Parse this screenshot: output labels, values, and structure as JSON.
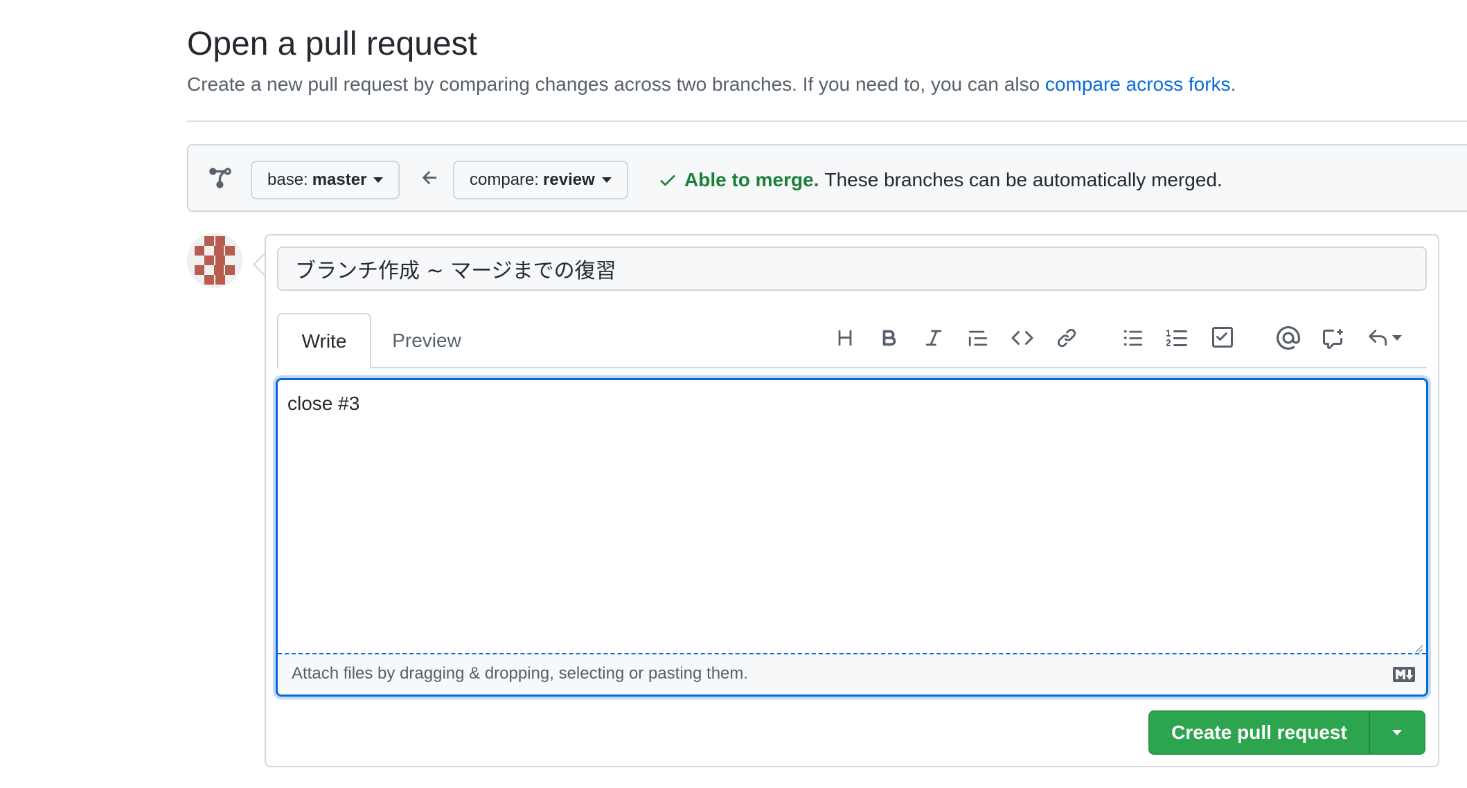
{
  "header": {
    "title": "Open a pull request",
    "subtitle": "Create a new pull request by comparing changes across two branches. If you need to, you can also ",
    "subtitle_link": "compare across forks",
    "subtitle_end": "."
  },
  "range": {
    "base_prefix": "base:",
    "base_branch": "master",
    "compare_prefix": "compare:",
    "compare_branch": "review",
    "merge_ok": "Able to merge.",
    "merge_text": "These branches can be automatically merged."
  },
  "form": {
    "title_value": "ブランチ作成 ~ マージまでの復習",
    "tabs": [
      "Write",
      "Preview"
    ],
    "body_value": "close #3",
    "attach_text": "Attach files by dragging & dropping, selecting or pasting them.",
    "submit_label": "Create pull request"
  },
  "toolbar": {
    "icons": [
      "heading-icon",
      "bold-icon",
      "italic-icon",
      "quote-icon",
      "code-icon",
      "link-icon",
      "unordered-list-icon",
      "ordered-list-icon",
      "task-list-icon",
      "mention-icon",
      "cross-reference-icon",
      "reply-icon"
    ]
  },
  "colors": {
    "accent": "#0969da",
    "success": "#1a7f37",
    "button": "#2da44e",
    "avatar": "#b85c50"
  }
}
